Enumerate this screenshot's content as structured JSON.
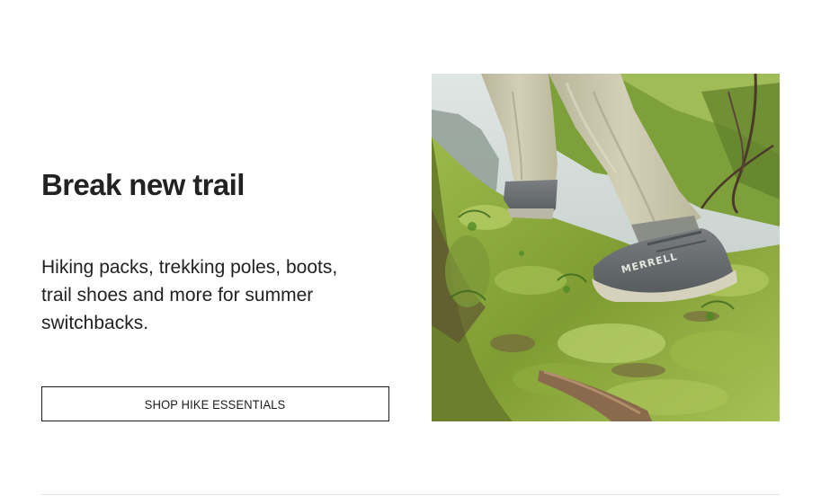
{
  "promo": {
    "headline": "Break new trail",
    "body": "Hiking packs, trekking poles, boots, trail shoes and more for summer switchbacks.",
    "cta_label": "SHOP HIKE ESSENTIALS"
  },
  "hero_image": {
    "alt": "Hiker in MERRELL trail shoes stepping over a mossy forest slope",
    "shoe_brand": "MERRELL"
  },
  "colors": {
    "text": "#222222",
    "button_border": "#1b1b1b",
    "background": "#ffffff",
    "moss": "#8fae3e",
    "pants": "#c9c6ad",
    "shoe": "#6c7072"
  }
}
